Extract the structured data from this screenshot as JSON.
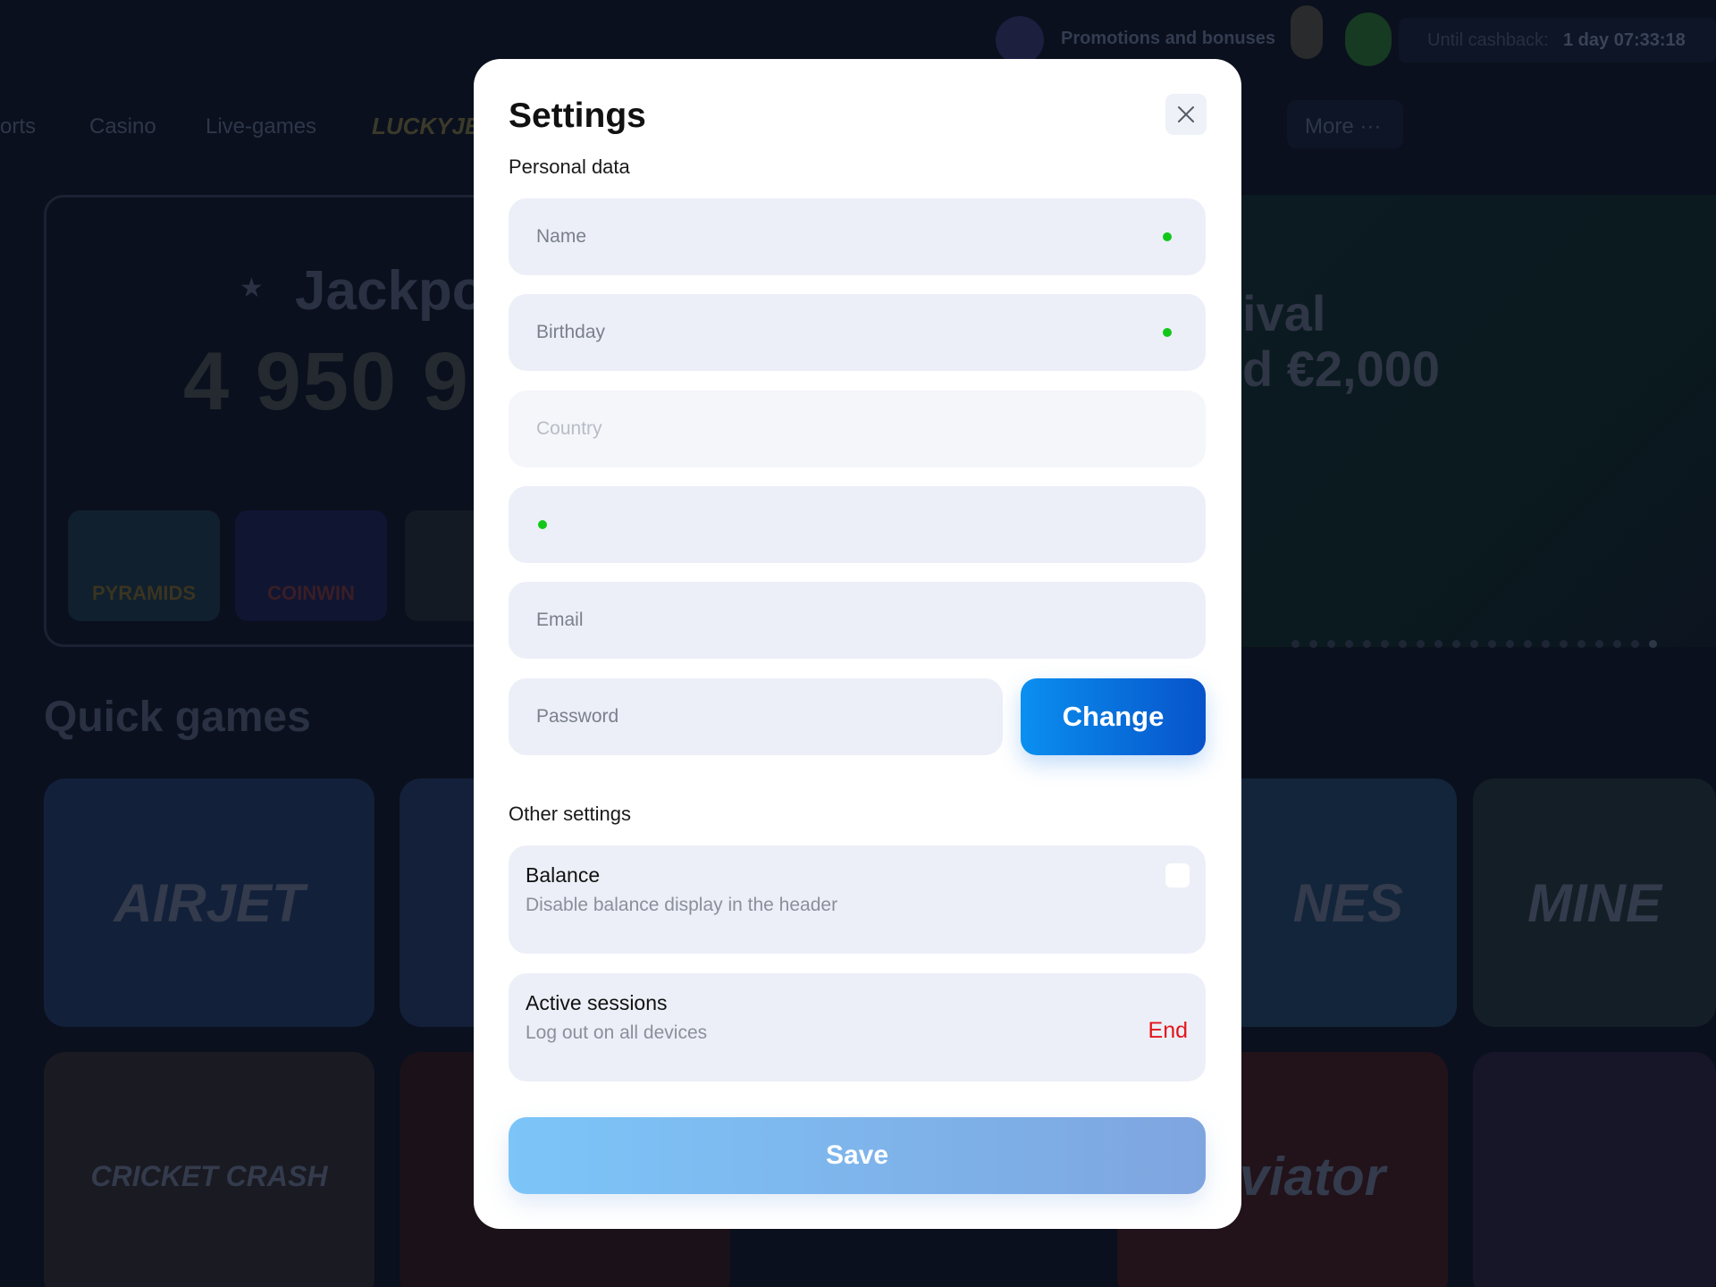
{
  "header": {
    "promotions_label": "Promotions and bonuses",
    "cashback_label": "Until cashback:",
    "cashback_time": "1 day 07:33:18"
  },
  "nav": {
    "items": [
      "orts",
      "Casino",
      "Live-games"
    ],
    "logo": "LUCKYJET",
    "more_label": "More",
    "more_icon": "ellipsis-icon"
  },
  "jackpot": {
    "title": "Jackpot",
    "amount": "4 950 9",
    "games": [
      "PYRAMIDS",
      "COINWIN",
      ""
    ]
  },
  "banner": {
    "line1": "ival",
    "line2": "d €2,000",
    "slides": 21,
    "active_slide": 21
  },
  "quick_games": {
    "title": "Quick games",
    "tiles": [
      "AIRJET",
      "",
      "NES",
      "MINE",
      "CRICKET CRASH",
      "",
      "Aviator",
      ""
    ]
  },
  "modal": {
    "title": "Settings",
    "close_icon": "close-icon",
    "personal_section": "Personal data",
    "fields": {
      "name": {
        "placeholder": "Name",
        "value": ""
      },
      "birthday": {
        "placeholder": "Birthday",
        "value": ""
      },
      "country": {
        "placeholder": "Country",
        "value": ""
      },
      "phone": {
        "placeholder": "",
        "value": ""
      },
      "email": {
        "placeholder": "Email",
        "value": ""
      },
      "password": {
        "placeholder": "Password",
        "value": ""
      }
    },
    "change_label": "Change",
    "other_section": "Other settings",
    "balance": {
      "title": "Balance",
      "subtitle": "Disable balance display in the header",
      "checked": false
    },
    "sessions": {
      "title": "Active sessions",
      "subtitle": "Log out on all devices",
      "action": "End"
    },
    "save_label": "Save"
  },
  "colors": {
    "accent": "#0a8ff0",
    "danger": "#e4141b",
    "valid_dot": "#12c719",
    "field_bg": "#eceff7"
  }
}
